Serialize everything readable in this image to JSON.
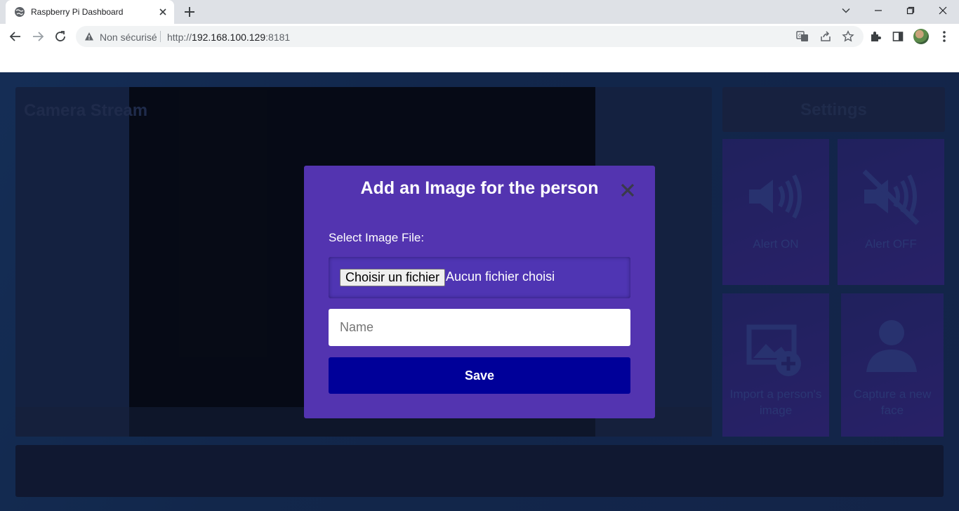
{
  "browser": {
    "tab_title": "Raspberry Pi Dashboard",
    "security_label": "Non sécurisé",
    "url_scheme": "http://",
    "url_host": "192.168.100.129",
    "url_port": ":8181"
  },
  "dashboard": {
    "camera_title": "Camera Stream",
    "settings_title": "Settings",
    "tiles": [
      {
        "label": "Alert ON",
        "icon": "speaker-on-icon"
      },
      {
        "label": "Alert OFF",
        "icon": "speaker-off-icon"
      },
      {
        "label": "Import a person's image",
        "icon": "add-image-icon"
      },
      {
        "label": "Capture a new face",
        "icon": "user-icon"
      }
    ]
  },
  "modal": {
    "title": "Add an Image for the person",
    "file_label": "Select Image File:",
    "file_button": "Choisir un fichier",
    "file_status": "Aucun fichier choisi",
    "name_placeholder": "Name",
    "save_label": "Save"
  },
  "colors": {
    "modal_bg": "#5334b0",
    "save_button_bg": "#000099",
    "page_bg": "#1b3766"
  }
}
